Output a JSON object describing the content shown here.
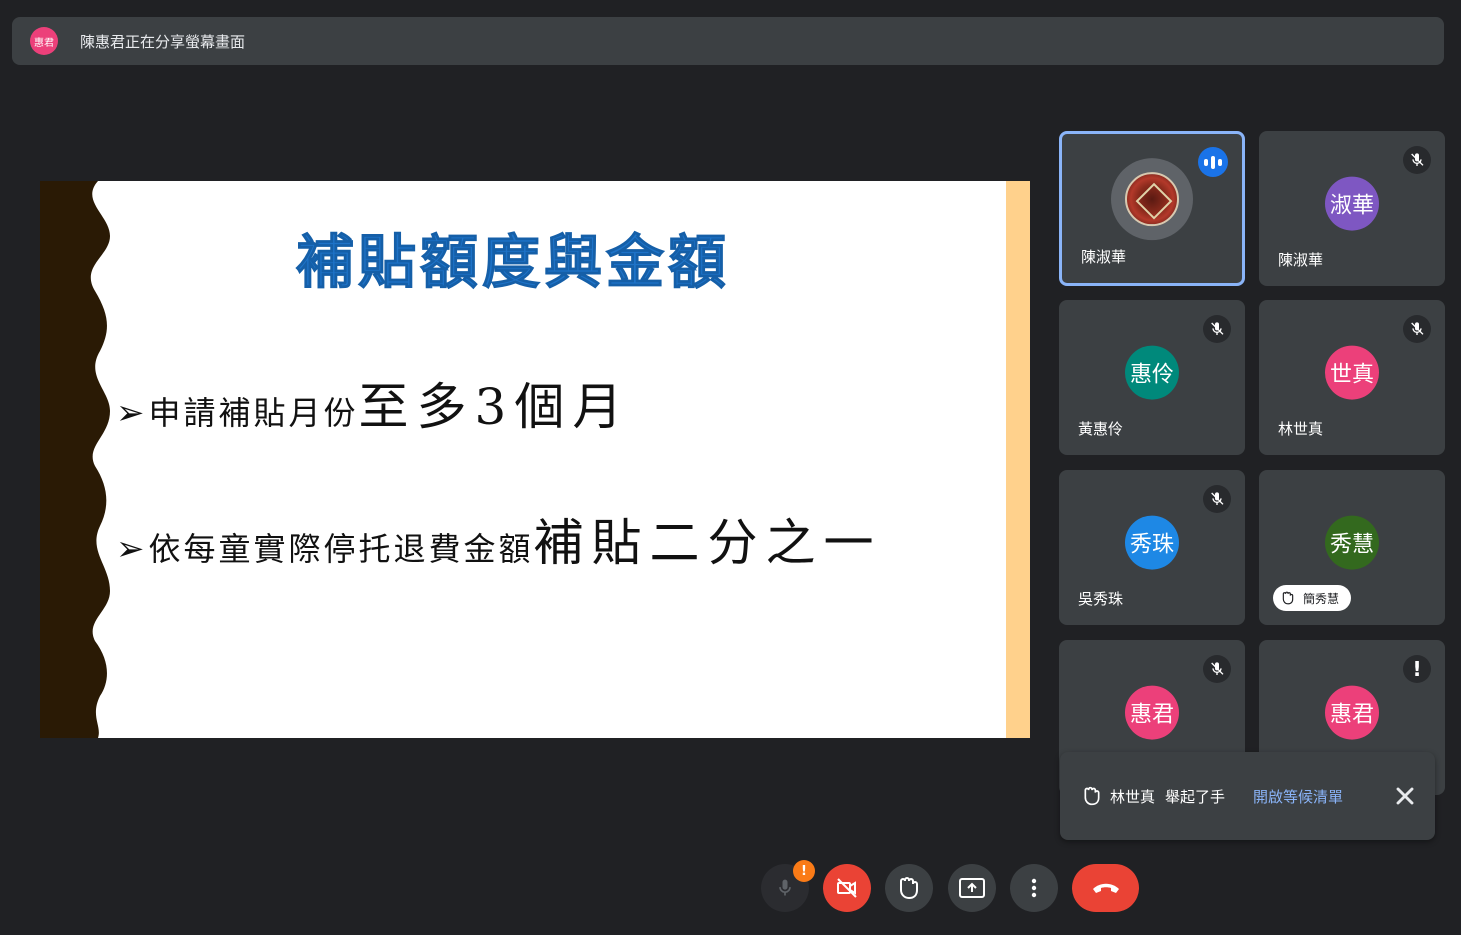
{
  "share_bar": {
    "avatar_text": "惠君",
    "message": "陳惠君正在分享螢幕畫面"
  },
  "slide": {
    "title": "補貼額度與金額",
    "bullet1_small": "申請補貼月份",
    "bullet1_big": "至多3個月",
    "bullet2_small": "依每童實際停托退費金額",
    "bullet2_big": "補貼二分之一",
    "arrow": "➢"
  },
  "tiles": [
    {
      "name": "陳淑華",
      "avatar": "",
      "color": "#5f6368",
      "status": "speaking",
      "photo": true
    },
    {
      "name": "陳淑華",
      "avatar": "淑華",
      "color": "#7e57c2",
      "status": "muted"
    },
    {
      "name": "黃惠伶",
      "avatar": "惠伶",
      "color": "#00897b",
      "status": "muted"
    },
    {
      "name": "林世真",
      "avatar": "世真",
      "color": "#ec407a",
      "status": "muted"
    },
    {
      "name": "吳秀珠",
      "avatar": "秀珠",
      "color": "#1e88e5",
      "status": "muted"
    },
    {
      "name": "簡秀慧",
      "avatar": "秀慧",
      "color": "#33691e",
      "status": "hand-raised"
    },
    {
      "name": "",
      "avatar": "惠君",
      "color": "#ec407a",
      "status": "muted"
    },
    {
      "name": "",
      "avatar": "惠君",
      "color": "#ec407a",
      "status": "warning"
    }
  ],
  "toast": {
    "who": "林世真",
    "what": "舉起了手",
    "link": "開啟等候清單"
  },
  "controls": {
    "mic_badge": "!",
    "colors": {
      "danger": "#ea4335",
      "warning": "#fa7b17",
      "accent": "#8ab4f8"
    }
  }
}
